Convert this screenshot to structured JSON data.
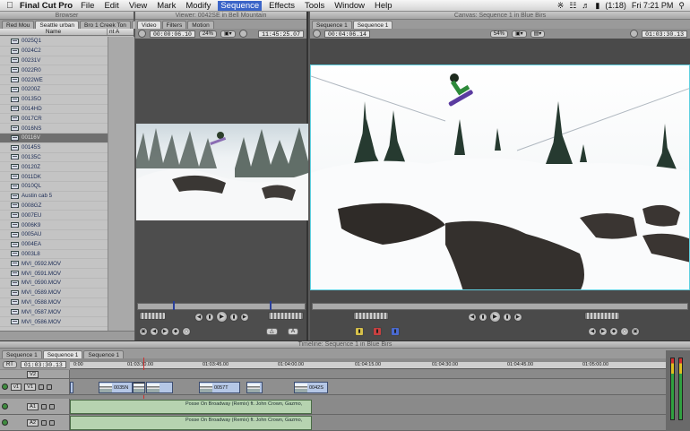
{
  "menubar": {
    "app_name": "Final Cut Pro",
    "items": [
      "File",
      "Edit",
      "View",
      "Mark",
      "Modify",
      "Sequence",
      "Effects",
      "Tools",
      "Window",
      "Help"
    ],
    "active_item": "Sequence",
    "battery": "(1:18)",
    "clock": "Fri 7:21 PM"
  },
  "browser": {
    "title": "Browser",
    "tabs": [
      "Red Mou",
      "Seattle urban",
      "Bro 1 Creek Ton",
      "»"
    ],
    "selected_tab": "Seattle urban",
    "col_name": "Name",
    "col_other": "nt A",
    "clips": [
      "0025Q1",
      "0024C2",
      "00231V",
      "0022R0",
      "0022WE",
      "00200Z",
      "00135O",
      "0014HD",
      "0017CR",
      "0016NS",
      "00116V",
      "00145S",
      "00135C",
      "00120Z",
      "0011DK",
      "0010QL",
      "Austin cab 5",
      "0008GZ",
      "0007EU",
      "0006K9",
      "0005AU",
      "0004EA",
      "0003L8",
      "MVI_0592.MOV",
      "MVI_0591.MOV",
      "MVI_0590.MOV",
      "MVI_0589.MOV",
      "MVI_0588.MOV",
      "MVI_0587.MOV",
      "MVI_0586.MOV"
    ],
    "selected_clip": "00116V"
  },
  "viewer": {
    "title": "Viewer: 0042SE in Bell Mountain",
    "tabs": [
      "Video",
      "Filters",
      "Motion"
    ],
    "timecode_duration": "00:00:06.10",
    "zoom": "24%",
    "timecode_current": "11:45:25.07"
  },
  "canvas": {
    "title": "Canvas: Sequence 1 in Blue Birs",
    "tabs": [
      "Sequence 1",
      "Sequence 1"
    ],
    "timecode_duration": "00:04:06.14",
    "zoom": "54%",
    "timecode_current": "01:03:30.13"
  },
  "timeline": {
    "title": "Timeline: Sequence 1 in Blue Birs",
    "tabs": [
      "Sequence 1",
      "Sequence 1",
      "Sequence 1"
    ],
    "rt_label": "RT",
    "current_tc": "01:03:30.13",
    "ruler_marks": [
      "0:00",
      "01:03:30.00",
      "01:03:45.00",
      "01:04:00.00",
      "01:04:15.00",
      "01:04:30.00",
      "01:04:45.00",
      "01:05:00.00"
    ],
    "tracks": {
      "v2_label": "V2",
      "v1_src": "v1",
      "v1_label": "V1",
      "a1_label": "A1",
      "a2_label": "A2"
    },
    "video_clips": [
      "0035N",
      "",
      "0057T",
      "",
      "0042S"
    ],
    "audio_clip_name": "Posse On Broadway (Remix) ft. John Crown, Gazmo,"
  }
}
